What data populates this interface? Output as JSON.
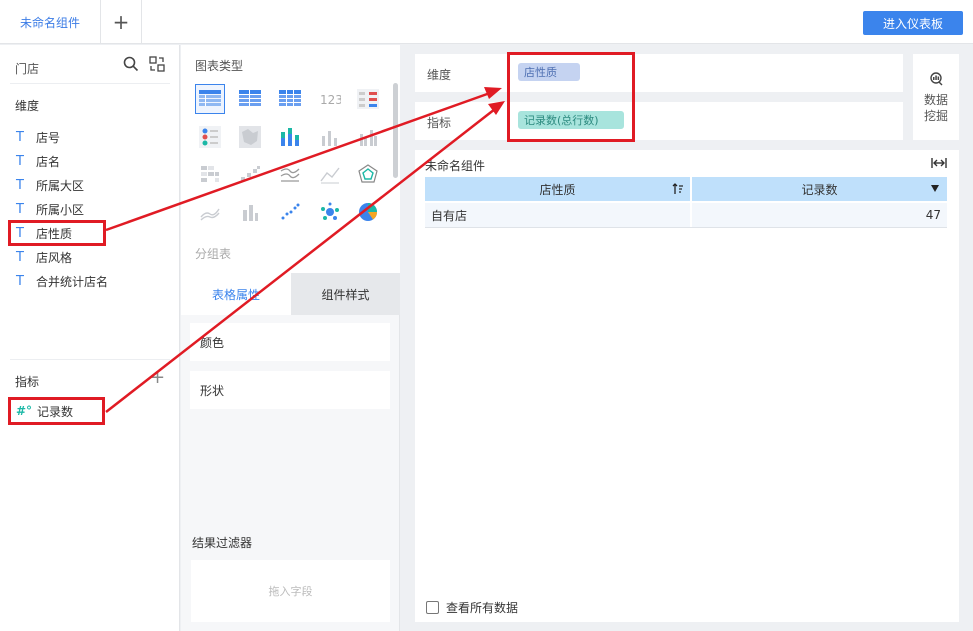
{
  "topbar": {
    "active_tab": "未命名组件",
    "add_tab": "+",
    "enter_dashboard": "进入仪表板"
  },
  "left_panel": {
    "dataset_name": "门店",
    "dimension_title": "维度",
    "dimension_type_glyph": "T",
    "dimensions": [
      "店号",
      "店名",
      "所属大区",
      "所属小区",
      "店性质",
      "店风格",
      "合并统计店名"
    ],
    "measure_title": "指标",
    "measure_add": "+",
    "measure_type_glyph": "#°",
    "measures": [
      "记录数"
    ]
  },
  "middle_panel": {
    "chart_type_title": "图表类型",
    "group_label": "分组表",
    "tabs": [
      "表格属性",
      "组件样式"
    ],
    "properties": [
      "颜色",
      "形状"
    ],
    "filter_title": "结果过滤器",
    "filter_placeholder": "拖入字段"
  },
  "right_panel": {
    "dimension_label": "维度",
    "dimension_pill": "店性质",
    "measure_label": "指标",
    "measure_pill": "记录数(总行数)",
    "mining_line1": "数据",
    "mining_line2": "挖掘",
    "component_title": "未命名组件",
    "table": {
      "headers": [
        "店性质",
        "记录数"
      ],
      "rows": [
        [
          "自有店",
          "47"
        ]
      ]
    },
    "show_all": "查看所有数据"
  },
  "colors": {
    "accent": "#3b84ec",
    "annotation": "#e01b24",
    "dimension_pill": "#c5d3f1",
    "measure_pill": "#a8e4dd",
    "table_header": "#bfe0fb"
  }
}
